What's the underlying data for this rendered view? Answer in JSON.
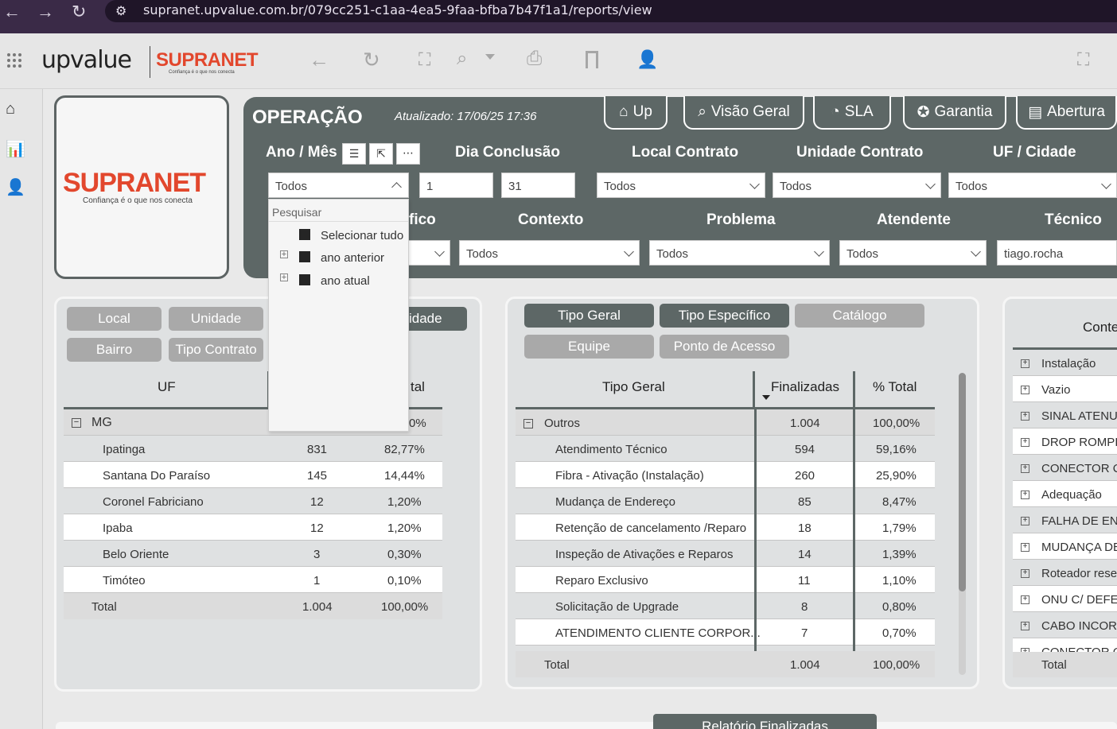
{
  "browser": {
    "url": "supranet.upvalue.com.br/079cc251-c1aa-4ea5-9faa-bfba7b47f1a1/reports/view"
  },
  "app": {
    "brand_upvalue": "upvalue",
    "brand_supranet": "SUPRANET",
    "brand_tagline": "Confiança é o que nos conecta"
  },
  "logo_card": {
    "name": "SUPRANET",
    "tagline": "Confiança é o que nos conecta"
  },
  "header": {
    "title": "OPERAÇÃO",
    "updated": "Atualizado: 17/06/25 17:36",
    "nav_buttons": [
      "Up",
      "Visão Geral",
      "SLA",
      "Garantia",
      "Abertura"
    ],
    "filters_row1": {
      "labels": [
        "Ano / Mês",
        "Dia Conclusão",
        "Local Contrato",
        "Unidade Contrato",
        "UF / Cidade"
      ],
      "ano_mes_value": "Todos",
      "dia_from": "1",
      "dia_to": "31",
      "local_contrato": "Todos",
      "unidade_contrato": "Todos",
      "uf_cidade": "Todos"
    },
    "filters_row2": {
      "labels": [
        "fico",
        "Contexto",
        "Problema",
        "Atendente",
        "Técnico"
      ],
      "contexto": "Todos",
      "problema": "Todos",
      "atendente": "Todos",
      "tecnico": "tiago.rocha"
    }
  },
  "dropdown": {
    "search_placeholder": "Pesquisar",
    "items": [
      "Selecionar tudo",
      "ano anterior",
      "ano atual"
    ]
  },
  "panel_uf": {
    "buttons": [
      "Local",
      "Unidade",
      "Bairro",
      "Tipo Contrato",
      "idade"
    ],
    "headers": [
      "UF",
      "tal"
    ],
    "group": {
      "name": "MG",
      "pct": "0%"
    },
    "rows": [
      {
        "name": "Ipatinga",
        "fin": "831",
        "pct": "82,77%"
      },
      {
        "name": "Santana Do Paraíso",
        "fin": "145",
        "pct": "14,44%"
      },
      {
        "name": "Coronel Fabriciano",
        "fin": "12",
        "pct": "1,20%"
      },
      {
        "name": "Ipaba",
        "fin": "12",
        "pct": "1,20%"
      },
      {
        "name": "Belo Oriente",
        "fin": "3",
        "pct": "0,30%"
      },
      {
        "name": "Timóteo",
        "fin": "1",
        "pct": "0,10%"
      }
    ],
    "total": {
      "label": "Total",
      "fin": "1.004",
      "pct": "100,00%"
    }
  },
  "panel_tipo": {
    "buttons": [
      "Tipo Geral",
      "Tipo Específico",
      "Catálogo",
      "Equipe",
      "Ponto de Acesso"
    ],
    "headers": [
      "Tipo Geral",
      "Finalizadas",
      "% Total"
    ],
    "group": {
      "name": "Outros",
      "fin": "1.004",
      "pct": "100,00%"
    },
    "rows": [
      {
        "name": "Atendimento Técnico",
        "fin": "594",
        "pct": "59,16%"
      },
      {
        "name": "Fibra - Ativação (Instalação)",
        "fin": "260",
        "pct": "25,90%"
      },
      {
        "name": "Mudança de Endereço",
        "fin": "85",
        "pct": "8,47%"
      },
      {
        "name": "Retenção de cancelamento /Reparo",
        "fin": "18",
        "pct": "1,79%"
      },
      {
        "name": "Inspeção de Ativações e Reparos",
        "fin": "14",
        "pct": "1,39%"
      },
      {
        "name": "Reparo Exclusivo",
        "fin": "11",
        "pct": "1,10%"
      },
      {
        "name": "Solicitação de Upgrade",
        "fin": "8",
        "pct": "0,80%"
      },
      {
        "name": "ATENDIMENTO CLIENTE CORPOR...",
        "fin": "7",
        "pct": "0,70%"
      }
    ],
    "total": {
      "label": "Total",
      "fin": "1.004",
      "pct": "100,00%"
    }
  },
  "panel_contexto": {
    "header": "Conte",
    "rows": [
      "Instalação",
      "Vazio",
      "SINAL ATENUA",
      "DROP ROMPID",
      "CONECTOR QU",
      "Adequação",
      "FALHA DE ENE",
      "MUDANÇA DE",
      "Roteador reset",
      "ONU C/ DEFEI",
      "CABO INCORR",
      "CONECTOR CO"
    ],
    "total": "Total"
  },
  "bottom": {
    "tab_label": "Relatório Finalizadas"
  }
}
